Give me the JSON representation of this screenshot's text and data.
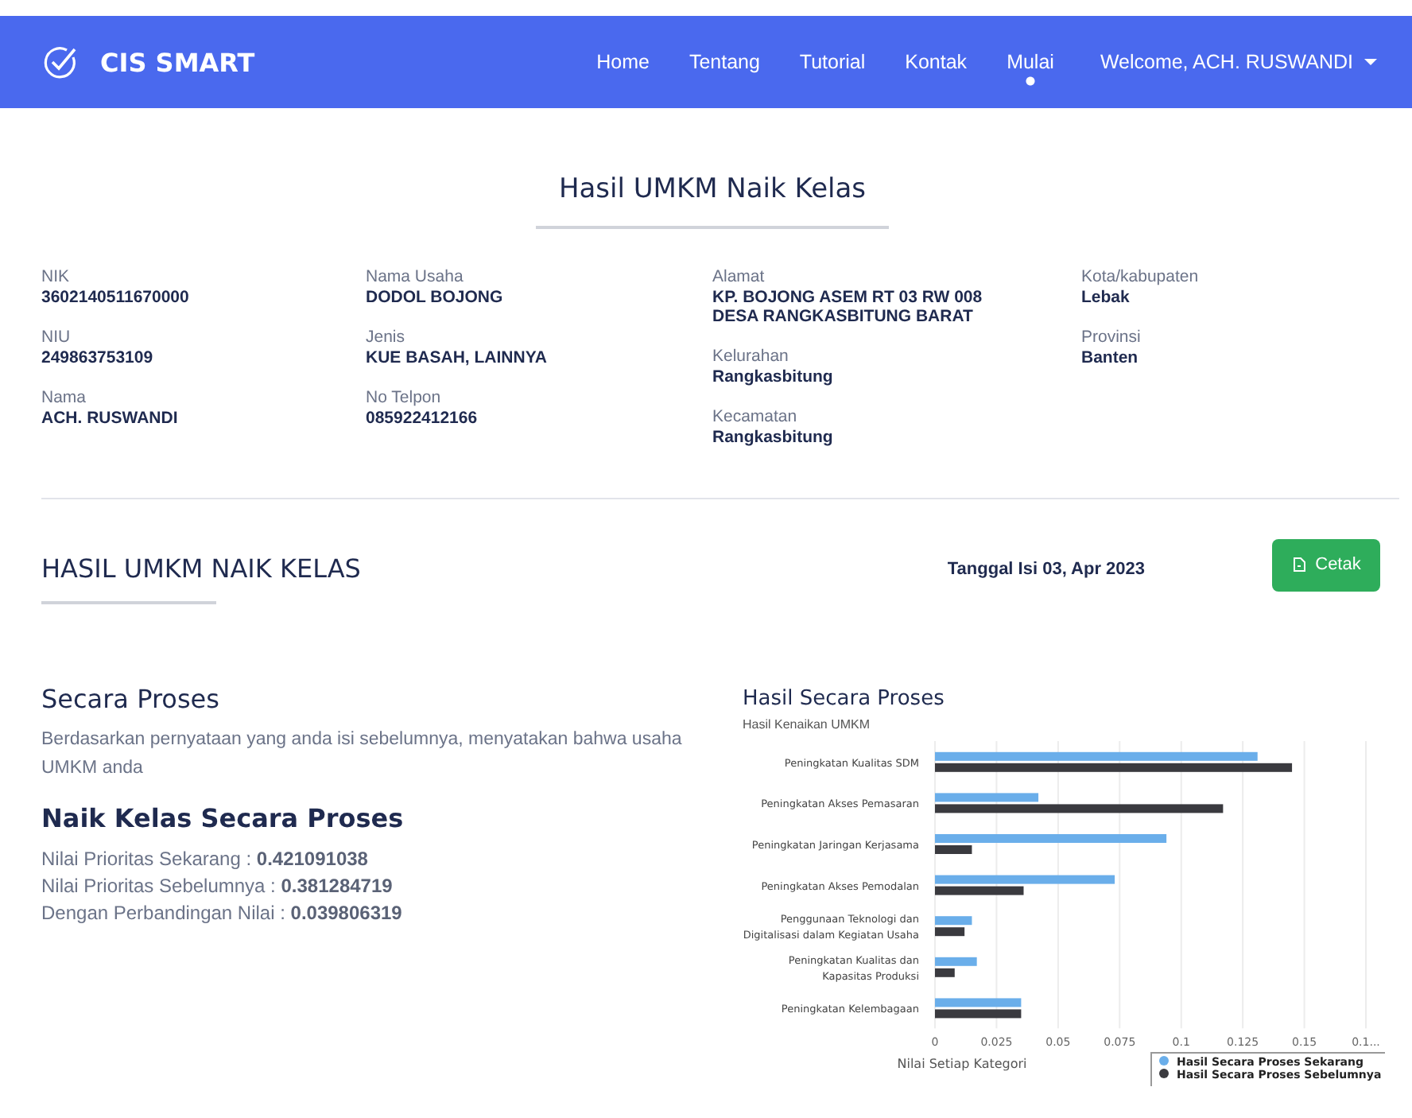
{
  "navbar": {
    "brand": "CIS SMART",
    "items": [
      {
        "label": "Home",
        "selected": false
      },
      {
        "label": "Tentang",
        "selected": false
      },
      {
        "label": "Tutorial",
        "selected": false
      },
      {
        "label": "Kontak",
        "selected": false
      },
      {
        "label": "Mulai",
        "selected": true
      }
    ],
    "user_menu": "Welcome, ACH. RUSWANDI"
  },
  "page_title": "Hasil UMKM Naik Kelas",
  "profile": {
    "columns": [
      [
        {
          "label": "NIK",
          "value": "3602140511670000"
        },
        {
          "label": "NIU",
          "value": "249863753109"
        },
        {
          "label": "Nama",
          "value": "ACH. RUSWANDI"
        }
      ],
      [
        {
          "label": "Nama Usaha",
          "value": "DODOL BOJONG"
        },
        {
          "label": "Jenis",
          "value": "KUE BASAH, LAINNYA"
        },
        {
          "label": "No Telpon",
          "value": "085922412166"
        }
      ],
      [
        {
          "label": "Alamat",
          "value": "KP. BOJONG ASEM RT 03 RW 008 DESA RANGKASBITUNG BARAT"
        },
        {
          "label": "Kelurahan",
          "value": "Rangkasbitung"
        },
        {
          "label": "Kecamatan",
          "value": "Rangkasbitung"
        }
      ],
      [
        {
          "label": "Kota/kabupaten",
          "value": "Lebak"
        },
        {
          "label": "Provinsi",
          "value": "Banten"
        }
      ]
    ]
  },
  "result": {
    "heading": "HASIL UMKM NAIK KELAS",
    "date": "Tanggal Isi 03, Apr 2023",
    "print_button": "Cetak"
  },
  "process": {
    "title": "Secara Proses",
    "description": "Berdasarkan pernyataan yang anda isi sebelumnya, menyatakan bahwa usaha UMKM anda",
    "verdict": "Naik Kelas Secara Proses",
    "scores": [
      "Nilai Prioritas Sekarang : **0.421091038**",
      "Nilai Prioritas Sebelumnya : **0.381284719**",
      "Dengan Perbandingan Nilai : **0.039806319**"
    ]
  },
  "chart": {
    "chart_data": {
      "type": "bar",
      "orientation": "horizontal",
      "title": "Hasil Secara Proses",
      "subtitle": "Hasil Kenaikan UMKM",
      "xlabel": "Nilai Setiap Kategori",
      "categories": [
        "Peningkatan Kualitas SDM",
        "Peningkatan Akses Pemasaran",
        "Peningkatan Jaringan Kerjasama",
        "Peningkatan Akses Pemodalan",
        "Penggunaan Teknologi dan Digitalisasi dalam Kegiatan Usaha",
        "Peningkatan Kualitas dan Kapasitas Produksi",
        "Peningkatan Kelembagaan"
      ],
      "series": [
        {
          "name": "Hasil Secara Proses Sekarang",
          "color": "#6aaeea",
          "values": [
            0.131,
            0.042,
            0.094,
            0.073,
            0.015,
            0.017,
            0.035
          ]
        },
        {
          "name": "Hasil Secara Proses Sebelumnya",
          "color": "#3a3a3f",
          "values": [
            0.145,
            0.117,
            0.015,
            0.036,
            0.012,
            0.008,
            0.035
          ]
        }
      ],
      "xlim": [
        0,
        0.175
      ],
      "grid": true,
      "legend": true,
      "xticks": [
        0,
        0.025,
        0.05,
        0.075,
        0.1,
        0.125,
        0.15,
        {
          "value": 0.175,
          "label": "0.1..."
        }
      ]
    }
  }
}
